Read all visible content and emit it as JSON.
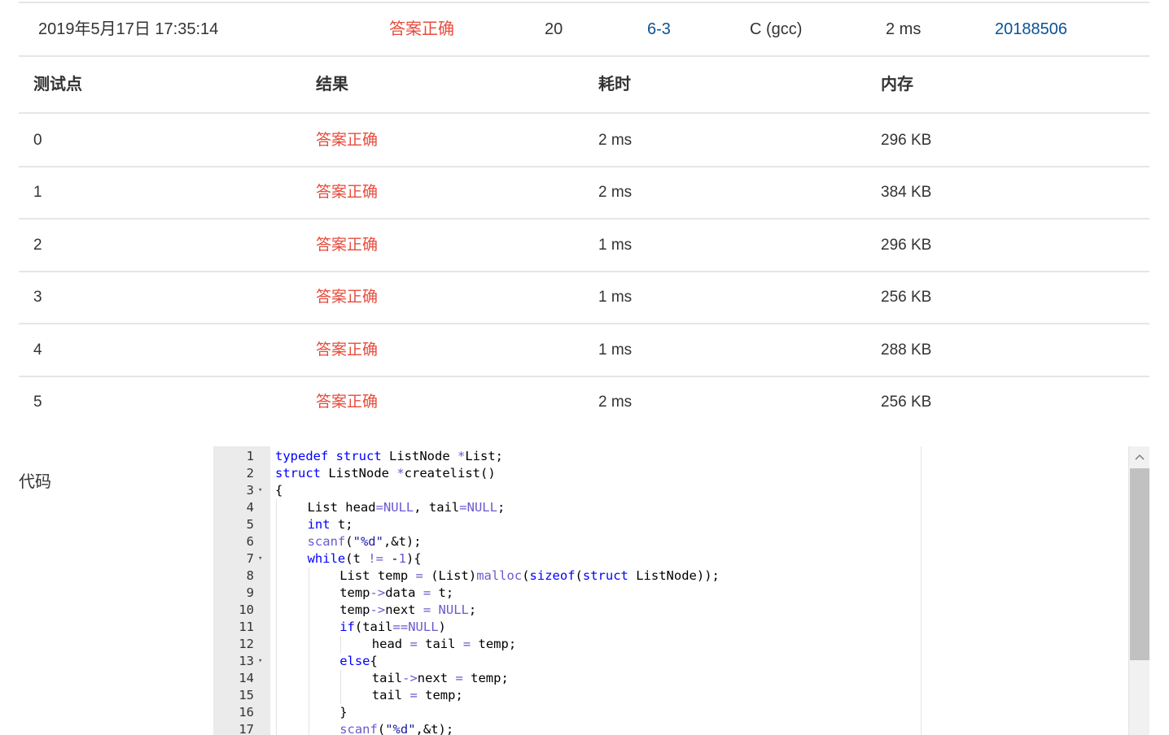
{
  "submission": {
    "time": "2019年5月17日 17:35:14",
    "status": "答案正确",
    "score": "20",
    "problem": "6-3",
    "compiler": "C (gcc)",
    "duration": "2 ms",
    "user": "20188506"
  },
  "table": {
    "headers": [
      "测试点",
      "结果",
      "耗时",
      "内存"
    ],
    "rows": [
      {
        "id": "0",
        "result": "答案正确",
        "time": "2 ms",
        "memory": "296 KB"
      },
      {
        "id": "1",
        "result": "答案正确",
        "time": "2 ms",
        "memory": "384 KB"
      },
      {
        "id": "2",
        "result": "答案正确",
        "time": "1 ms",
        "memory": "296 KB"
      },
      {
        "id": "3",
        "result": "答案正确",
        "time": "1 ms",
        "memory": "256 KB"
      },
      {
        "id": "4",
        "result": "答案正确",
        "time": "1 ms",
        "memory": "288 KB"
      },
      {
        "id": "5",
        "result": "答案正确",
        "time": "2 ms",
        "memory": "256 KB"
      }
    ]
  },
  "code": {
    "label": "代码",
    "lines": [
      {
        "n": "1",
        "fold": false,
        "indent": 0,
        "text": "typedef struct ListNode *List;"
      },
      {
        "n": "2",
        "fold": false,
        "indent": 0,
        "text": "struct ListNode *createlist()"
      },
      {
        "n": "3",
        "fold": true,
        "indent": 0,
        "text": "{"
      },
      {
        "n": "4",
        "fold": false,
        "indent": 1,
        "text": "List head=NULL, tail=NULL;"
      },
      {
        "n": "5",
        "fold": false,
        "indent": 1,
        "text": "int t;"
      },
      {
        "n": "6",
        "fold": false,
        "indent": 1,
        "text": "scanf(\"%d\",&t);"
      },
      {
        "n": "7",
        "fold": true,
        "indent": 1,
        "text": "while(t != -1){"
      },
      {
        "n": "8",
        "fold": false,
        "indent": 2,
        "text": "List temp = (List)malloc(sizeof(struct ListNode));"
      },
      {
        "n": "9",
        "fold": false,
        "indent": 2,
        "text": "temp->data = t;"
      },
      {
        "n": "10",
        "fold": false,
        "indent": 2,
        "text": "temp->next = NULL;"
      },
      {
        "n": "11",
        "fold": false,
        "indent": 2,
        "text": "if(tail==NULL)"
      },
      {
        "n": "12",
        "fold": false,
        "indent": 3,
        "text": "head = tail = temp;"
      },
      {
        "n": "13",
        "fold": true,
        "indent": 2,
        "text": "else{"
      },
      {
        "n": "14",
        "fold": false,
        "indent": 3,
        "text": "tail->next = temp;"
      },
      {
        "n": "15",
        "fold": false,
        "indent": 3,
        "text": "tail = temp;"
      },
      {
        "n": "16",
        "fold": false,
        "indent": 2,
        "text": "}"
      },
      {
        "n": "17",
        "fold": false,
        "indent": 2,
        "text": "scanf(\"%d\",&t);"
      }
    ]
  },
  "colors": {
    "status_ok": "#e74c3c",
    "link": "#0b5394",
    "keyword": "#0000ff"
  },
  "icons": {
    "fold": "fold-arrow-icon",
    "scroll_up": "chevron-up-icon"
  }
}
